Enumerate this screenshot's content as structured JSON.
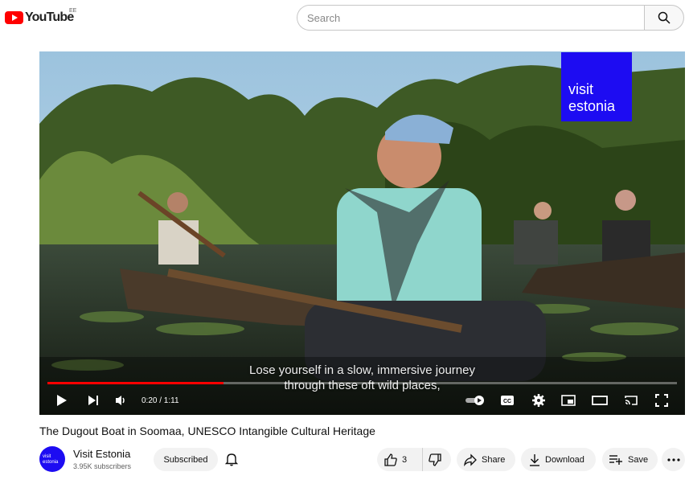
{
  "header": {
    "logo_text": "YouTube",
    "country_code": "EE",
    "search_placeholder": "Search",
    "icons": {
      "logo": "youtube-logo-icon",
      "search": "search-icon"
    }
  },
  "player": {
    "brand_line1": "visit",
    "brand_line2": "estonia",
    "subtitle_line1": "Lose yourself in a slow, immersive journey",
    "subtitle_line2": "through these oft wild places,",
    "time_display": "0:20 / 1:11",
    "progress_fraction": 0.28,
    "colors": {
      "progress": "#ff0000",
      "brand_box": "#1d0cf2"
    },
    "controls": [
      "play-icon",
      "next-icon",
      "volume-icon",
      "autoplay-toggle-icon",
      "cc-icon",
      "settings-gear-icon",
      "miniplayer-icon",
      "theater-mode-icon",
      "cast-icon",
      "fullscreen-icon"
    ]
  },
  "video": {
    "title": "The Dugout Boat in Soomaa, UNESCO Intangible Cultural Heritage"
  },
  "channel": {
    "name": "Visit Estonia",
    "subscribers": "3.95K subscribers",
    "avatar_line1": "visit",
    "avatar_line2": "estonia",
    "subscribe_label": "Subscribed"
  },
  "actions": {
    "like_count": "3",
    "share_label": "Share",
    "download_label": "Download",
    "save_label": "Save"
  }
}
